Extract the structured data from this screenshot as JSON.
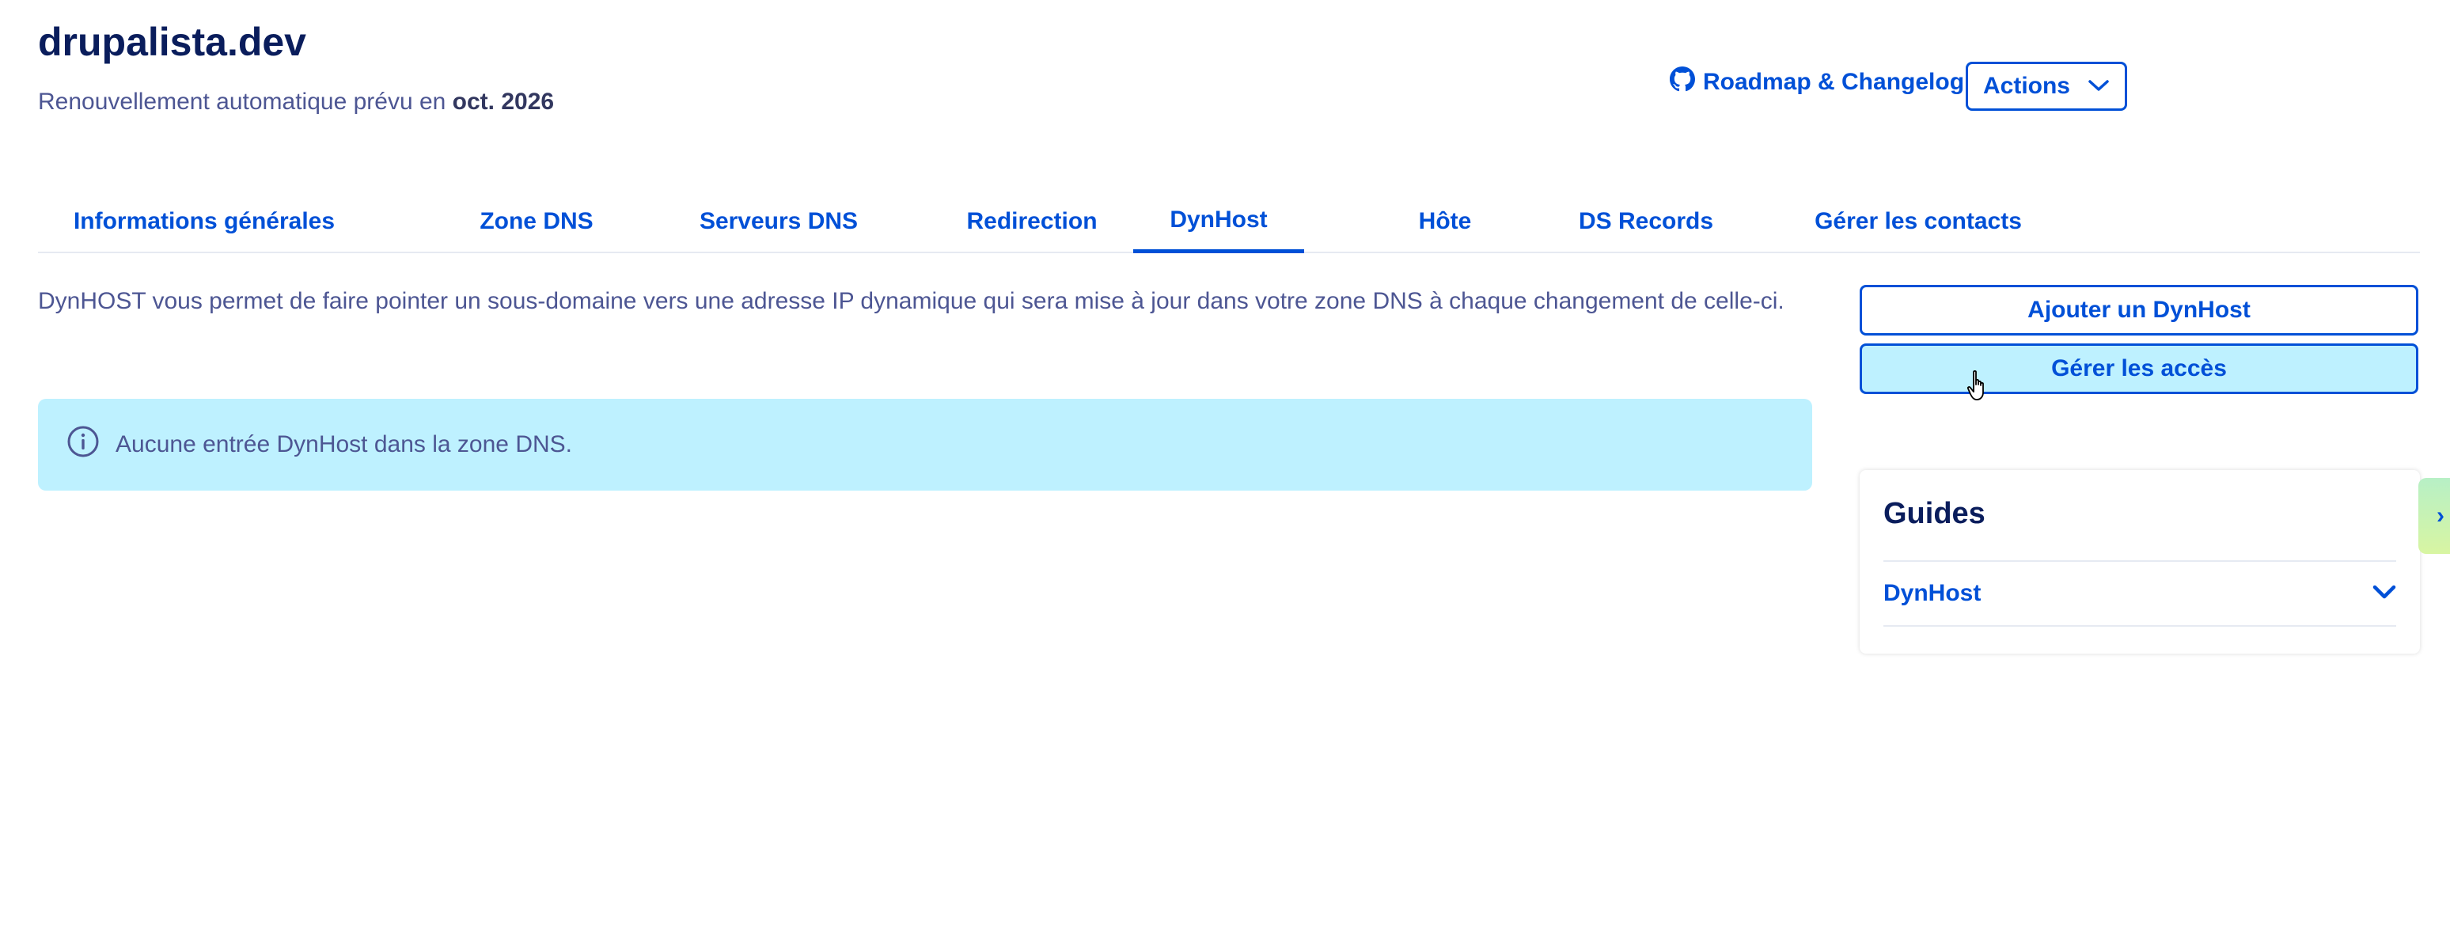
{
  "header": {
    "domain_name": "drupalista.dev",
    "renewal_prefix": "Renouvellement automatique prévu en ",
    "renewal_date": "oct. 2026",
    "roadmap_label": "Roadmap & Changelog",
    "actions_label": "Actions"
  },
  "tabs": [
    {
      "label": "Informations générales"
    },
    {
      "label": "Zone DNS"
    },
    {
      "label": "Serveurs DNS"
    },
    {
      "label": "Redirection"
    },
    {
      "label": "DynHost",
      "active": true
    },
    {
      "label": "Hôte"
    },
    {
      "label": "DS Records"
    },
    {
      "label": "Gérer les contacts"
    }
  ],
  "main": {
    "description": "DynHOST vous permet de faire pointer un sous-domaine vers une adresse IP dynamique qui sera mise à jour dans votre zone DNS à chaque changement de celle-ci.",
    "alert_text": "Aucune entrée DynHost dans la zone DNS."
  },
  "sidebar": {
    "add_button": "Ajouter un DynHost",
    "manage_button": "Gérer les accès",
    "guides_title": "Guides",
    "guides_item": "DynHost",
    "side_tab_glyph": "›"
  },
  "colors": {
    "primary": "#0050d7",
    "heading": "#0a1d5c",
    "text": "#4d5693",
    "info_bg": "#bef1ff"
  },
  "icons": {
    "roadmap": "github-icon",
    "actions": "chevron-down-icon",
    "alert": "info-icon",
    "guides": "chevron-down-icon",
    "cursor": "hand-pointer-icon"
  }
}
